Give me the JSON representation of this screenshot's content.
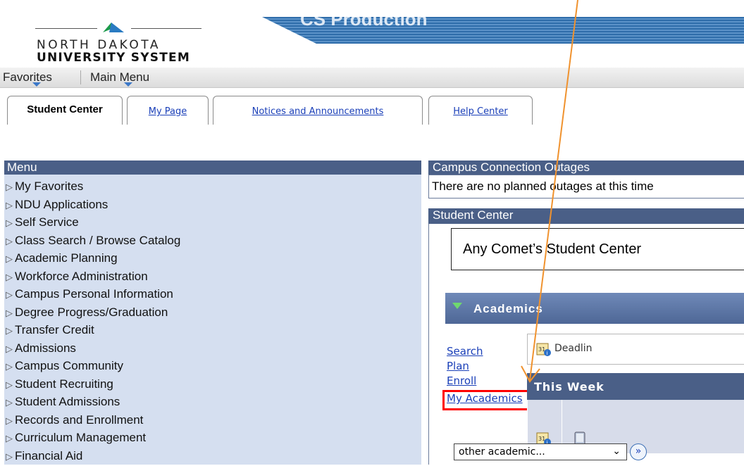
{
  "colors": {
    "header_blue": "#4a5f87",
    "link_blue": "#1a3fb8",
    "menu_bg": "#d5dff0",
    "highlight_red": "#ff0000",
    "annotation_arrow": "#f0922e"
  },
  "logo": {
    "line1": "NORTH DAKOTA",
    "line2": "UNIVERSITY SYSTEM",
    "icon": "ndus-logo-icon"
  },
  "banner": {
    "title": "CS Production"
  },
  "menubar": {
    "favorites": "Favorites",
    "main_menu": "Main Menu"
  },
  "tabs": [
    {
      "label": "Student Center",
      "active": true
    },
    {
      "label": "My Page",
      "active": false
    },
    {
      "label": "Notices and Announcements",
      "active": false
    },
    {
      "label": "Help Center",
      "active": false
    }
  ],
  "left_menu": {
    "title": "Menu",
    "items": [
      "My Favorites",
      "NDU Applications",
      "Self Service",
      "Class Search / Browse Catalog",
      "Academic Planning",
      "Workforce Administration",
      "Campus Personal Information",
      "Degree Progress/Graduation",
      "Transfer Credit",
      "Admissions",
      "Campus Community",
      "Student Recruiting",
      "Student Admissions",
      "Records and Enrollment",
      "Curriculum Management",
      "Financial Aid"
    ]
  },
  "outages": {
    "title": "Campus Connection Outages",
    "message": "There are no planned outages at this time"
  },
  "student_center": {
    "title": "Student Center",
    "name_callout": "Any Comet’s Student Center",
    "academics_label": "Academics",
    "links": [
      "Search",
      "Plan",
      "Enroll",
      "My Academics"
    ],
    "deadlines_label": "Deadlin",
    "this_week_label": "This Week",
    "other_academic_select": "other academic...",
    "go_button": "»"
  }
}
